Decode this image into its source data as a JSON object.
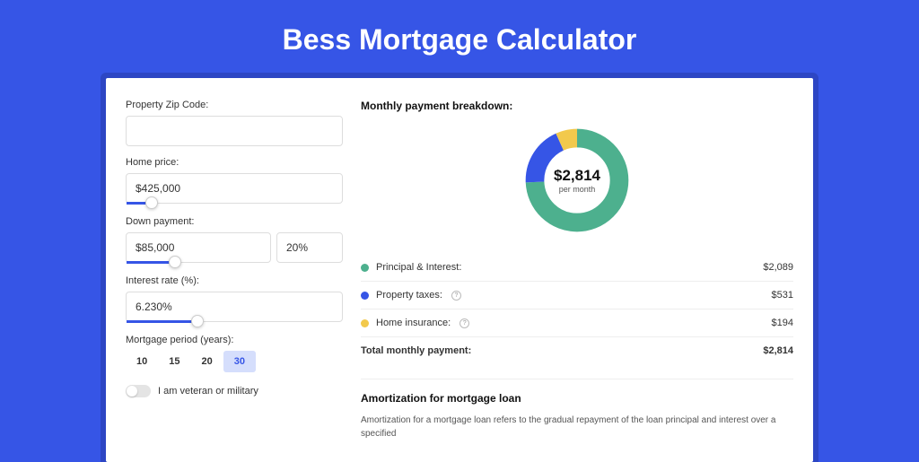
{
  "page": {
    "title": "Bess Mortgage Calculator"
  },
  "form": {
    "zip": {
      "label": "Property Zip Code:",
      "value": ""
    },
    "home_price": {
      "label": "Home price:",
      "value": "$425,000",
      "slider_pct": 9
    },
    "down_payment": {
      "label": "Down payment:",
      "amount": "$85,000",
      "percent": "20%",
      "slider_pct": 20
    },
    "interest_rate": {
      "label": "Interest rate (%):",
      "value": "6.230%",
      "slider_pct": 30
    },
    "period": {
      "label": "Mortgage period (years):",
      "options": [
        "10",
        "15",
        "20",
        "30"
      ],
      "active": "30"
    },
    "veteran": {
      "label": "I am veteran or military",
      "on": false
    }
  },
  "breakdown": {
    "title": "Monthly payment breakdown:",
    "donut": {
      "amount": "$2,814",
      "sub": "per month"
    },
    "items": [
      {
        "label": "Principal & Interest:",
        "value": "$2,089",
        "color": "#4db08e",
        "help": false
      },
      {
        "label": "Property taxes:",
        "value": "$531",
        "color": "#3655e6",
        "help": true
      },
      {
        "label": "Home insurance:",
        "value": "$194",
        "color": "#f2c94c",
        "help": true
      }
    ],
    "total": {
      "label": "Total monthly payment:",
      "value": "$2,814"
    }
  },
  "amort": {
    "title": "Amortization for mortgage loan",
    "text": "Amortization for a mortgage loan refers to the gradual repayment of the loan principal and interest over a specified"
  },
  "chart_data": {
    "type": "pie",
    "title": "Monthly payment breakdown",
    "categories": [
      "Principal & Interest",
      "Property taxes",
      "Home insurance"
    ],
    "values": [
      2089,
      531,
      194
    ],
    "colors": [
      "#4db08e",
      "#3655e6",
      "#f2c94c"
    ],
    "total": 2814,
    "center_label": "$2,814 per month"
  }
}
